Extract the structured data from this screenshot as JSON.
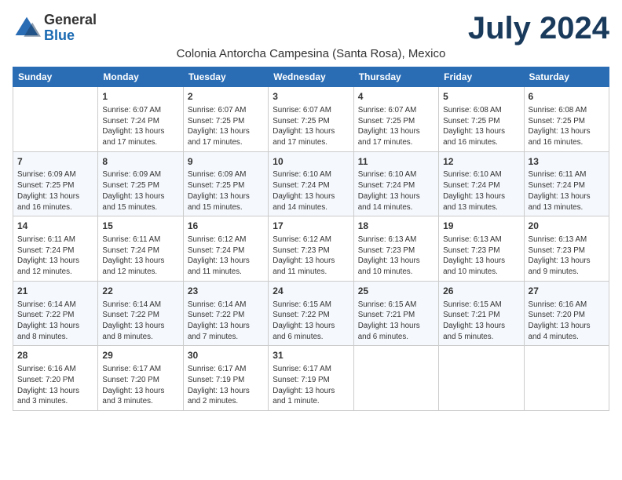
{
  "logo": {
    "general": "General",
    "blue": "Blue"
  },
  "title": "July 2024",
  "subtitle": "Colonia Antorcha Campesina (Santa Rosa), Mexico",
  "days_of_week": [
    "Sunday",
    "Monday",
    "Tuesday",
    "Wednesday",
    "Thursday",
    "Friday",
    "Saturday"
  ],
  "weeks": [
    [
      {
        "day": "",
        "content": ""
      },
      {
        "day": "1",
        "content": "Sunrise: 6:07 AM\nSunset: 7:24 PM\nDaylight: 13 hours\nand 17 minutes."
      },
      {
        "day": "2",
        "content": "Sunrise: 6:07 AM\nSunset: 7:25 PM\nDaylight: 13 hours\nand 17 minutes."
      },
      {
        "day": "3",
        "content": "Sunrise: 6:07 AM\nSunset: 7:25 PM\nDaylight: 13 hours\nand 17 minutes."
      },
      {
        "day": "4",
        "content": "Sunrise: 6:07 AM\nSunset: 7:25 PM\nDaylight: 13 hours\nand 17 minutes."
      },
      {
        "day": "5",
        "content": "Sunrise: 6:08 AM\nSunset: 7:25 PM\nDaylight: 13 hours\nand 16 minutes."
      },
      {
        "day": "6",
        "content": "Sunrise: 6:08 AM\nSunset: 7:25 PM\nDaylight: 13 hours\nand 16 minutes."
      }
    ],
    [
      {
        "day": "7",
        "content": "Sunrise: 6:09 AM\nSunset: 7:25 PM\nDaylight: 13 hours\nand 16 minutes."
      },
      {
        "day": "8",
        "content": "Sunrise: 6:09 AM\nSunset: 7:25 PM\nDaylight: 13 hours\nand 15 minutes."
      },
      {
        "day": "9",
        "content": "Sunrise: 6:09 AM\nSunset: 7:25 PM\nDaylight: 13 hours\nand 15 minutes."
      },
      {
        "day": "10",
        "content": "Sunrise: 6:10 AM\nSunset: 7:24 PM\nDaylight: 13 hours\nand 14 minutes."
      },
      {
        "day": "11",
        "content": "Sunrise: 6:10 AM\nSunset: 7:24 PM\nDaylight: 13 hours\nand 14 minutes."
      },
      {
        "day": "12",
        "content": "Sunrise: 6:10 AM\nSunset: 7:24 PM\nDaylight: 13 hours\nand 13 minutes."
      },
      {
        "day": "13",
        "content": "Sunrise: 6:11 AM\nSunset: 7:24 PM\nDaylight: 13 hours\nand 13 minutes."
      }
    ],
    [
      {
        "day": "14",
        "content": "Sunrise: 6:11 AM\nSunset: 7:24 PM\nDaylight: 13 hours\nand 12 minutes."
      },
      {
        "day": "15",
        "content": "Sunrise: 6:11 AM\nSunset: 7:24 PM\nDaylight: 13 hours\nand 12 minutes."
      },
      {
        "day": "16",
        "content": "Sunrise: 6:12 AM\nSunset: 7:24 PM\nDaylight: 13 hours\nand 11 minutes."
      },
      {
        "day": "17",
        "content": "Sunrise: 6:12 AM\nSunset: 7:23 PM\nDaylight: 13 hours\nand 11 minutes."
      },
      {
        "day": "18",
        "content": "Sunrise: 6:13 AM\nSunset: 7:23 PM\nDaylight: 13 hours\nand 10 minutes."
      },
      {
        "day": "19",
        "content": "Sunrise: 6:13 AM\nSunset: 7:23 PM\nDaylight: 13 hours\nand 10 minutes."
      },
      {
        "day": "20",
        "content": "Sunrise: 6:13 AM\nSunset: 7:23 PM\nDaylight: 13 hours\nand 9 minutes."
      }
    ],
    [
      {
        "day": "21",
        "content": "Sunrise: 6:14 AM\nSunset: 7:22 PM\nDaylight: 13 hours\nand 8 minutes."
      },
      {
        "day": "22",
        "content": "Sunrise: 6:14 AM\nSunset: 7:22 PM\nDaylight: 13 hours\nand 8 minutes."
      },
      {
        "day": "23",
        "content": "Sunrise: 6:14 AM\nSunset: 7:22 PM\nDaylight: 13 hours\nand 7 minutes."
      },
      {
        "day": "24",
        "content": "Sunrise: 6:15 AM\nSunset: 7:22 PM\nDaylight: 13 hours\nand 6 minutes."
      },
      {
        "day": "25",
        "content": "Sunrise: 6:15 AM\nSunset: 7:21 PM\nDaylight: 13 hours\nand 6 minutes."
      },
      {
        "day": "26",
        "content": "Sunrise: 6:15 AM\nSunset: 7:21 PM\nDaylight: 13 hours\nand 5 minutes."
      },
      {
        "day": "27",
        "content": "Sunrise: 6:16 AM\nSunset: 7:20 PM\nDaylight: 13 hours\nand 4 minutes."
      }
    ],
    [
      {
        "day": "28",
        "content": "Sunrise: 6:16 AM\nSunset: 7:20 PM\nDaylight: 13 hours\nand 3 minutes."
      },
      {
        "day": "29",
        "content": "Sunrise: 6:17 AM\nSunset: 7:20 PM\nDaylight: 13 hours\nand 3 minutes."
      },
      {
        "day": "30",
        "content": "Sunrise: 6:17 AM\nSunset: 7:19 PM\nDaylight: 13 hours\nand 2 minutes."
      },
      {
        "day": "31",
        "content": "Sunrise: 6:17 AM\nSunset: 7:19 PM\nDaylight: 13 hours\nand 1 minute."
      },
      {
        "day": "",
        "content": ""
      },
      {
        "day": "",
        "content": ""
      },
      {
        "day": "",
        "content": ""
      }
    ]
  ]
}
